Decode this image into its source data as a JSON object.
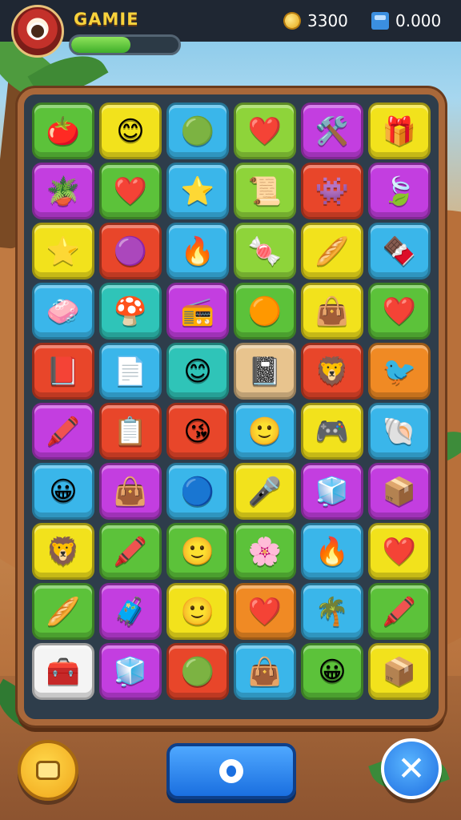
{
  "header": {
    "title": "GAMIE",
    "progress_fraction": 0.55,
    "coins": "3300",
    "gems": "0.000"
  },
  "board": {
    "tiles": [
      {
        "color": "green",
        "icon": "tomato"
      },
      {
        "color": "yellow",
        "icon": "smiley-face"
      },
      {
        "color": "blue",
        "icon": "green-blob"
      },
      {
        "color": "lime",
        "icon": "red-heart"
      },
      {
        "color": "magenta",
        "icon": "crossed-tools"
      },
      {
        "color": "yellow",
        "icon": "gift-box"
      },
      {
        "color": "magenta",
        "icon": "potted-plant"
      },
      {
        "color": "green",
        "icon": "red-heart"
      },
      {
        "color": "blue",
        "icon": "star"
      },
      {
        "color": "lime",
        "icon": "scroll"
      },
      {
        "color": "red",
        "icon": "blue-monster"
      },
      {
        "color": "magenta",
        "icon": "leaf"
      },
      {
        "color": "yellow",
        "icon": "star"
      },
      {
        "color": "red",
        "icon": "purple-monster"
      },
      {
        "color": "blue",
        "icon": "flame-leaf"
      },
      {
        "color": "lime",
        "icon": "candy"
      },
      {
        "color": "yellow",
        "icon": "bread"
      },
      {
        "color": "blue",
        "icon": "chocolate-bar"
      },
      {
        "color": "blue",
        "icon": "eraser"
      },
      {
        "color": "teal",
        "icon": "mushroom"
      },
      {
        "color": "magenta",
        "icon": "radio"
      },
      {
        "color": "green",
        "icon": "orange-monster"
      },
      {
        "color": "yellow",
        "icon": "red-bag"
      },
      {
        "color": "green",
        "icon": "red-heart"
      },
      {
        "color": "red",
        "icon": "book"
      },
      {
        "color": "blue",
        "icon": "note-paper"
      },
      {
        "color": "teal",
        "icon": "smiley-face"
      },
      {
        "color": "tan",
        "icon": "notebook"
      },
      {
        "color": "red",
        "icon": "lion"
      },
      {
        "color": "orange",
        "icon": "bird"
      },
      {
        "color": "magenta",
        "icon": "crayon"
      },
      {
        "color": "red",
        "icon": "list-board"
      },
      {
        "color": "red",
        "icon": "kiss-face"
      },
      {
        "color": "blue",
        "icon": "orange-face"
      },
      {
        "color": "yellow",
        "icon": "game-box"
      },
      {
        "color": "blue",
        "icon": "shell"
      },
      {
        "color": "blue",
        "icon": "green-face"
      },
      {
        "color": "magenta",
        "icon": "red-bag"
      },
      {
        "color": "blue",
        "icon": "blue-blob"
      },
      {
        "color": "yellow",
        "icon": "microphone"
      },
      {
        "color": "magenta",
        "icon": "cube"
      },
      {
        "color": "magenta",
        "icon": "blue-box"
      },
      {
        "color": "yellow",
        "icon": "lion"
      },
      {
        "color": "green",
        "icon": "crayon"
      },
      {
        "color": "green",
        "icon": "orange-face"
      },
      {
        "color": "green",
        "icon": "pink-leaf"
      },
      {
        "color": "blue",
        "icon": "flame-leaf"
      },
      {
        "color": "yellow",
        "icon": "red-heart"
      },
      {
        "color": "green",
        "icon": "bread"
      },
      {
        "color": "magenta",
        "icon": "blue-bag"
      },
      {
        "color": "yellow",
        "icon": "orange-face"
      },
      {
        "color": "orange",
        "icon": "red-heart"
      },
      {
        "color": "blue",
        "icon": "palm-tool"
      },
      {
        "color": "green",
        "icon": "crayon"
      },
      {
        "color": "white",
        "icon": "chest"
      },
      {
        "color": "magenta",
        "icon": "cube"
      },
      {
        "color": "red",
        "icon": "green-blob"
      },
      {
        "color": "blue",
        "icon": "red-bag"
      },
      {
        "color": "green",
        "icon": "green-face"
      },
      {
        "color": "yellow",
        "icon": "open-box"
      }
    ]
  },
  "footer": {
    "chat_icon": "chat-icon",
    "main_icon": "circle-icon",
    "close_icon": "close-icon"
  }
}
